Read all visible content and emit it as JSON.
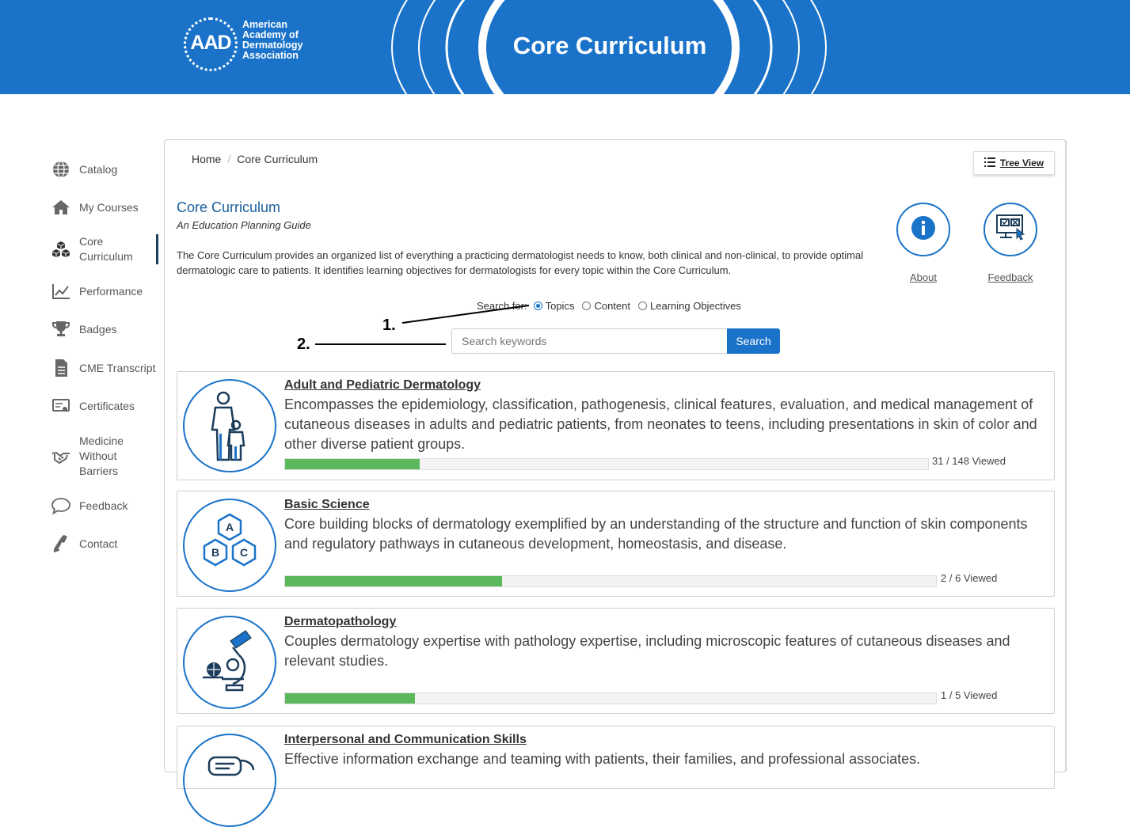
{
  "header": {
    "logo_mark": "AAD",
    "logo_lines": [
      "American",
      "Academy of",
      "Dermatology",
      "Association"
    ],
    "title": "Core Curriculum"
  },
  "sidebar": {
    "items": [
      {
        "label": "Catalog",
        "icon": "globe-icon"
      },
      {
        "label": "My Courses",
        "icon": "home-icon"
      },
      {
        "label": "Core Curriculum",
        "icon": "cubes-icon",
        "active": true
      },
      {
        "label": "Performance",
        "icon": "chart-icon"
      },
      {
        "label": "Badges",
        "icon": "trophy-icon"
      },
      {
        "label": "CME Transcript",
        "icon": "document-icon"
      },
      {
        "label": "Certificates",
        "icon": "certificate-icon"
      },
      {
        "label": "Medicine Without Barriers",
        "icon": "handshake-icon"
      },
      {
        "label": "Feedback",
        "icon": "speech-bubble-icon"
      },
      {
        "label": "Contact",
        "icon": "phone-icon"
      }
    ]
  },
  "breadcrumb": {
    "home": "Home",
    "current": "Core Curriculum"
  },
  "tree_view": {
    "label": "Tree View"
  },
  "main": {
    "title": "Core Curriculum",
    "subtitle": "An Education Planning Guide",
    "description": "The Core Curriculum provides an organized list of everything a practicing dermatologist needs to know, both clinical and non-clinical, to provide optimal dermatologic care to patients. It identifies learning objectives for dermatologists for every topic within the Core Curriculum.",
    "about_label": "About",
    "feedback_label": "Feedback"
  },
  "search": {
    "label": "Search for:",
    "options": [
      "Topics",
      "Content",
      "Learning Objectives"
    ],
    "selected": "Topics",
    "placeholder": "Search keywords",
    "button": "Search"
  },
  "annotations": {
    "one": "1.",
    "two": "2."
  },
  "topics": [
    {
      "title": "Adult and Pediatric Dermatology",
      "description": "Encompasses the epidemiology, classification, pathogenesis, clinical features, evaluation, and medical management of cutaneous diseases in adults and pediatric patients, from neonates to teens, including presentations in skin of color and other diverse patient groups.",
      "viewed": "31 / 148 Viewed",
      "progress": 0.209,
      "icon": "adult-child-icon"
    },
    {
      "title": "Basic Science",
      "description": "Core building blocks of dermatology exemplified by an understanding of the structure and function of skin components and regulatory pathways in cutaneous development, homeostasis, and disease.",
      "viewed": "2 / 6 Viewed",
      "progress": 0.333,
      "icon": "abc-hexagon-icon",
      "icon_letters": [
        "A",
        "B",
        "C"
      ]
    },
    {
      "title": "Dermatopathology",
      "description": "Couples dermatology expertise with pathology expertise, including microscopic features of cutaneous diseases and relevant studies.",
      "viewed": "1 / 5 Viewed",
      "progress": 0.2,
      "icon": "microscope-icon"
    },
    {
      "title": "Interpersonal and Communication Skills",
      "description": "Effective information exchange and teaming with patients, their families, and professional associates.",
      "icon": "chat-icon"
    }
  ],
  "colors": {
    "brand": "#1a73c9",
    "progress": "#5cb85c",
    "title": "#1a5e9e"
  }
}
